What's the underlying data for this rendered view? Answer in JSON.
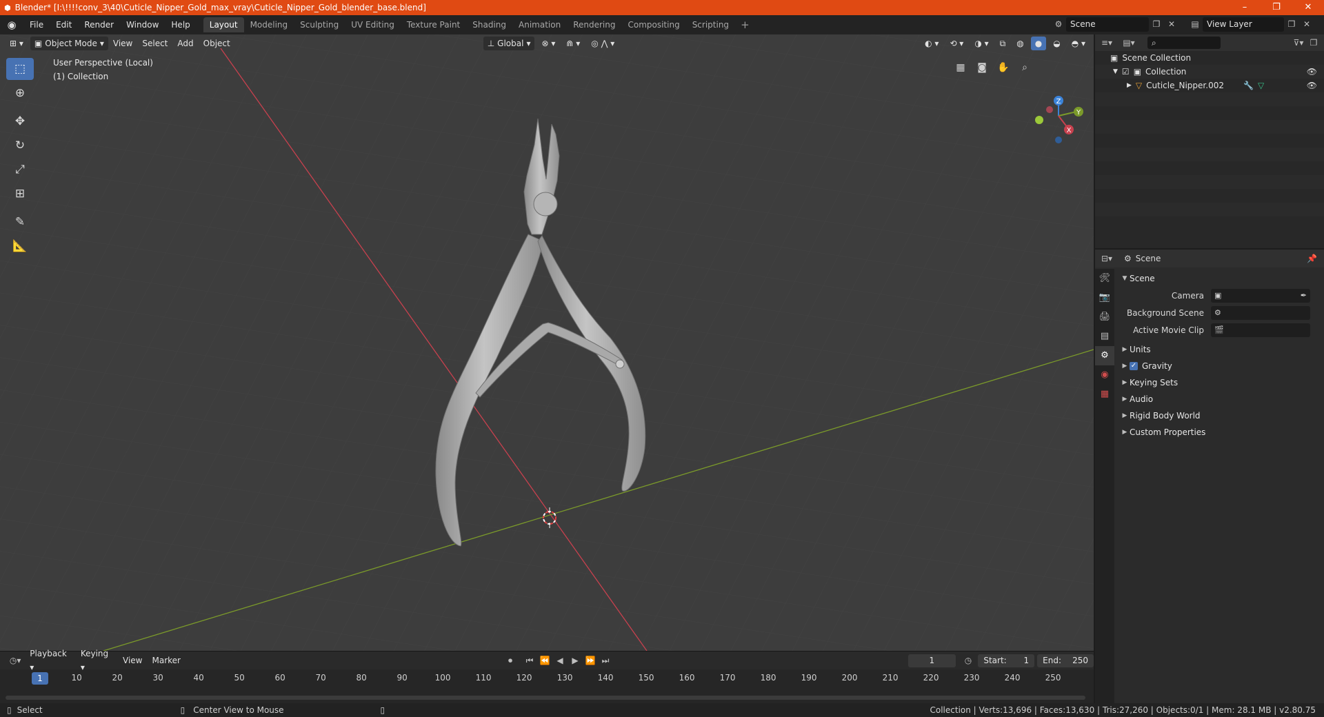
{
  "window": {
    "title": "Blender* [I:\\!!!!conv_3\\40\\Cuticle_Nipper_Gold_max_vray\\Cuticle_Nipper_Gold_blender_base.blend]",
    "minimize": "–",
    "maximize": "❐",
    "close": "✕"
  },
  "menu": [
    "File",
    "Edit",
    "Render",
    "Window",
    "Help"
  ],
  "workspaces": [
    "Layout",
    "Modeling",
    "Sculpting",
    "UV Editing",
    "Texture Paint",
    "Shading",
    "Animation",
    "Rendering",
    "Compositing",
    "Scripting"
  ],
  "active_workspace": "Layout",
  "scene_selector": "Scene",
  "view_layer": "View Layer",
  "viewport": {
    "mode": "Object Mode",
    "menus": [
      "View",
      "Select",
      "Add",
      "Object"
    ],
    "transform_orientation": "Global",
    "perspective_label": "User Perspective (Local)",
    "collection_label": "(1) Collection",
    "gizmo_axes": {
      "x": "X",
      "y": "Y",
      "z": "Z"
    }
  },
  "timeline": {
    "menus": [
      "Playback",
      "Keying",
      "View",
      "Marker"
    ],
    "current_frame": "1",
    "start_label": "Start:",
    "start": "1",
    "end_label": "End:",
    "end": "250",
    "ticks": [
      "10",
      "20",
      "30",
      "40",
      "50",
      "60",
      "70",
      "80",
      "90",
      "100",
      "110",
      "120",
      "130",
      "140",
      "150",
      "160",
      "170",
      "180",
      "190",
      "200",
      "210",
      "220",
      "230",
      "240",
      "250"
    ]
  },
  "status": {
    "left_action": "Select",
    "middle_action": "Center View to Mouse",
    "stats": "Collection | Verts:13,696 | Faces:13,630 | Tris:27,260 | Objects:0/1 | Mem: 28.1 MB | v2.80.75"
  },
  "outliner": {
    "root": "Scene Collection",
    "collection": "Collection",
    "object": "Cuticle_Nipper.002"
  },
  "properties": {
    "context": "Scene",
    "panel": "Scene",
    "camera_label": "Camera",
    "background_scene_label": "Background Scene",
    "active_movie_clip_label": "Active Movie Clip",
    "sections": [
      "Units",
      "Gravity",
      "Keying Sets",
      "Audio",
      "Rigid Body World",
      "Custom Properties"
    ]
  },
  "colors": {
    "accent": "#4772b3",
    "title_bar": "#e04a13",
    "x_axis": "#c8414e",
    "y_axis": "#7b9a2a",
    "z_axis": "#3b83d9"
  }
}
